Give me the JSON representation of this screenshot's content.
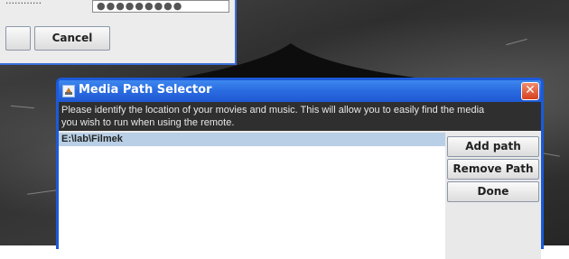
{
  "background_dialog": {
    "field_value": "●●●●●●●●●",
    "cancel_label": "Cancel"
  },
  "dialog": {
    "title": "Media Path Selector",
    "close_glyph": "✕",
    "info_line1": "Please identify the location of your movies and music. This will allow you to easily find the media",
    "info_line2": "you wish to run when using the remote.",
    "paths": [
      "E:\\lab\\Filmek"
    ],
    "buttons": {
      "add": "Add path",
      "remove": "Remove Path",
      "done": "Done"
    }
  },
  "colors": {
    "title_bar": "#2a6be0",
    "frame": "#1c5ad9",
    "selection": "#b8cfe5",
    "close": "#d6411f"
  }
}
